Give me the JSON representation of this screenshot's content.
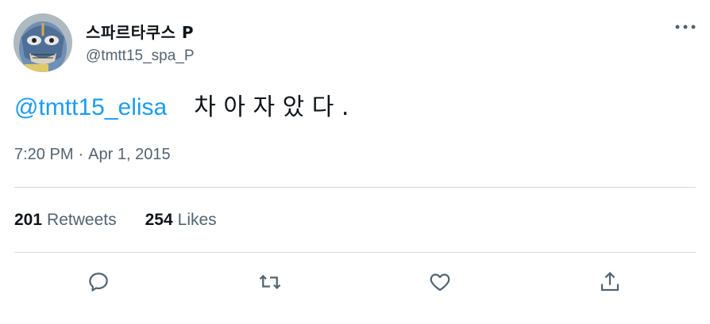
{
  "author": {
    "display_name": "스파르타쿠스 P",
    "handle": "@tmtt15_spa_P",
    "avatar_icon": "masked-luchador-avatar"
  },
  "tweet": {
    "mention": "@tmtt15_elisa",
    "text": "차  아  자  았  다  .",
    "time": "7:20 PM",
    "separator": "·",
    "date": "Apr 1, 2015"
  },
  "stats": {
    "retweets_count": "201",
    "retweets_label": "Retweets",
    "likes_count": "254",
    "likes_label": "Likes"
  },
  "actions": {
    "reply_icon": "reply-icon",
    "retweet_icon": "retweet-icon",
    "like_icon": "heart-icon",
    "share_icon": "share-icon"
  },
  "colors": {
    "link": "#1d9bf0",
    "secondary_text": "#536471",
    "primary_text": "#0f1419",
    "divider": "#d6dadd"
  }
}
